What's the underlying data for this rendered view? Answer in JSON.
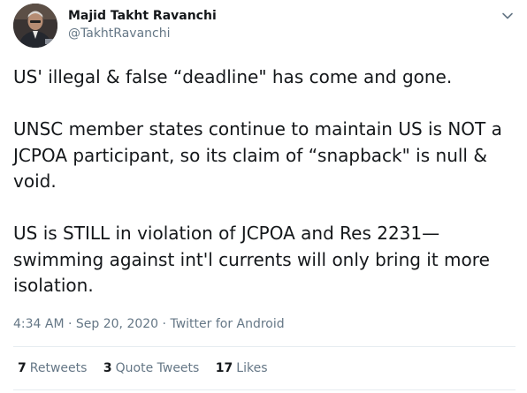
{
  "author": {
    "name": "Majid Takht Ravanchi",
    "handle": "@TakhtRavanchi"
  },
  "tweet": {
    "paragraphs": [
      "US' illegal & false “deadline\" has come and gone.",
      "UNSC member states continue to maintain US is NOT a JCPOA participant, so its claim of “snapback\" is null & void.",
      "US is STILL in violation of JCPOA and Res 2231—swimming against int'l currents will only bring it more isolation."
    ],
    "time": "4:34 AM",
    "date": "Sep 20, 2020",
    "separator": "·",
    "source": "Twitter for Android"
  },
  "stats": {
    "retweets": {
      "count": "7",
      "label": "Retweets"
    },
    "quote_tweets": {
      "count": "3",
      "label": "Quote Tweets"
    },
    "likes": {
      "count": "17",
      "label": "Likes"
    }
  },
  "icons": {
    "more": "chevron-down-icon"
  },
  "colors": {
    "text": "#14171a",
    "secondary": "#657786",
    "divider": "#e6ecf0"
  }
}
